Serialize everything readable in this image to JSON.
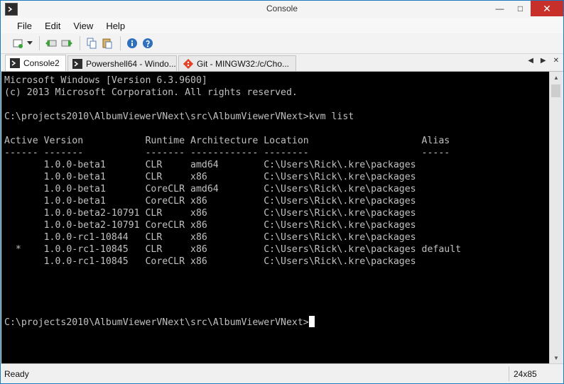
{
  "window": {
    "title": "Console"
  },
  "window_controls": {
    "minimize": "—",
    "maximize": "□",
    "close": "✕"
  },
  "menu": [
    "File",
    "Edit",
    "View",
    "Help"
  ],
  "tabs": [
    {
      "label": "Console2",
      "active": true
    },
    {
      "label": "Powershell64 - Windo...",
      "active": false
    },
    {
      "label": "Git - MINGW32:/c/Cho...",
      "active": false
    }
  ],
  "tab_nav": {
    "prev": "◀",
    "next": "▶",
    "close": "✕"
  },
  "console": {
    "lines": [
      "Microsoft Windows [Version 6.3.9600]",
      "(c) 2013 Microsoft Corporation. All rights reserved.",
      "",
      "C:\\projects2010\\AlbumViewerVNext\\src\\AlbumViewerVNext>kvm list",
      "",
      "Active Version           Runtime Architecture Location                    Alias",
      "------ -------           ------- ------------ --------                    -----",
      "       1.0.0-beta1       CLR     amd64        C:\\Users\\Rick\\.kre\\packages",
      "       1.0.0-beta1       CLR     x86          C:\\Users\\Rick\\.kre\\packages",
      "       1.0.0-beta1       CoreCLR amd64        C:\\Users\\Rick\\.kre\\packages",
      "       1.0.0-beta1       CoreCLR x86          C:\\Users\\Rick\\.kre\\packages",
      "       1.0.0-beta2-10791 CLR     x86          C:\\Users\\Rick\\.kre\\packages",
      "       1.0.0-beta2-10791 CoreCLR x86          C:\\Users\\Rick\\.kre\\packages",
      "       1.0.0-rc1-10844   CLR     x86          C:\\Users\\Rick\\.kre\\packages",
      "  *    1.0.0-rc1-10845   CLR     x86          C:\\Users\\Rick\\.kre\\packages default",
      "       1.0.0-rc1-10845   CoreCLR x86          C:\\Users\\Rick\\.kre\\packages",
      "",
      "",
      "",
      ""
    ],
    "prompt": "C:\\projects2010\\AlbumViewerVNext\\src\\AlbumViewerVNext>"
  },
  "scrollbar": {
    "up": "▲",
    "down": "▼"
  },
  "status": {
    "text": "Ready",
    "size": "24x85"
  },
  "colors": {
    "console_bg": "#000000",
    "console_fg": "#c0c0c0",
    "close_button": "#c7302a"
  }
}
